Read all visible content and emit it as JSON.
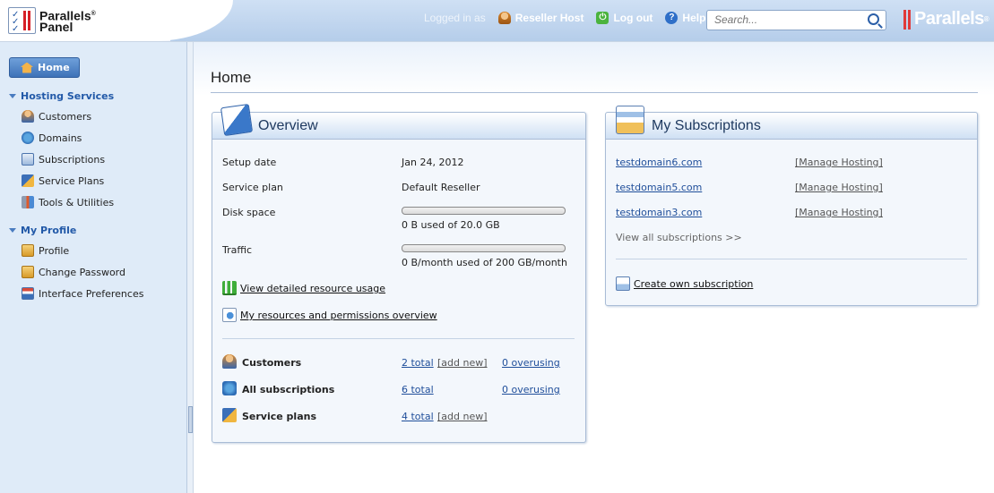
{
  "header": {
    "logo_line1": "Parallels",
    "logo_reg": "®",
    "logo_line2": "Panel",
    "logged_in_as": "Logged in as",
    "user_name": "Reseller Host",
    "logout_label": "Log out",
    "help_label": "Help",
    "search_placeholder": "Search...",
    "brand": "Parallels",
    "brand_reg": "®"
  },
  "sidebar": {
    "home_label": "Home",
    "sections": [
      {
        "title": "Hosting Services",
        "items": [
          {
            "label": "Customers",
            "icon": "customers-icon"
          },
          {
            "label": "Domains",
            "icon": "domains-icon"
          },
          {
            "label": "Subscriptions",
            "icon": "subscriptions-icon"
          },
          {
            "label": "Service Plans",
            "icon": "service-plans-icon"
          },
          {
            "label": "Tools & Utilities",
            "icon": "tools-icon"
          }
        ]
      },
      {
        "title": "My Profile",
        "items": [
          {
            "label": "Profile",
            "icon": "profile-icon"
          },
          {
            "label": "Change Password",
            "icon": "password-icon"
          },
          {
            "label": "Interface Preferences",
            "icon": "preferences-icon"
          }
        ]
      }
    ]
  },
  "main": {
    "title": "Home",
    "overview": {
      "title": "Overview",
      "setup_date_label": "Setup date",
      "setup_date": "Jan 24, 2012",
      "service_plan_label": "Service plan",
      "service_plan": "Default Reseller",
      "disk_space_label": "Disk space",
      "disk_space_text": "0 B used of 20.0 GB",
      "disk_space_fraction": 0,
      "traffic_label": "Traffic",
      "traffic_text": "0 B/month used of 200 GB/month",
      "traffic_fraction": 0,
      "resource_usage_link": "View detailed resource usage",
      "permissions_link": "My resources and permissions overview",
      "summary": [
        {
          "label": "Customers",
          "total": "2 total",
          "add": "[add new]",
          "overusing": "0 overusing"
        },
        {
          "label": "All subscriptions",
          "total": "6 total",
          "add": "",
          "overusing": "0 overusing"
        },
        {
          "label": "Service plans",
          "total": "4 total",
          "add": "[add new]",
          "overusing": ""
        }
      ]
    },
    "subscriptions": {
      "title": "My Subscriptions",
      "items": [
        {
          "domain": "testdomain6.com",
          "action": "[Manage Hosting]"
        },
        {
          "domain": "testdomain5.com",
          "action": "[Manage Hosting]"
        },
        {
          "domain": "testdomain3.com",
          "action": "[Manage Hosting]"
        }
      ],
      "view_all": "View all subscriptions >>",
      "create_own": "Create own subscription"
    }
  },
  "colors": {
    "accent": "#2259a8",
    "link": "#1f4e9a",
    "header_blue": "#b5cdea",
    "sidebar_bg": "#dfebf8",
    "brand_red": "#d62027"
  }
}
